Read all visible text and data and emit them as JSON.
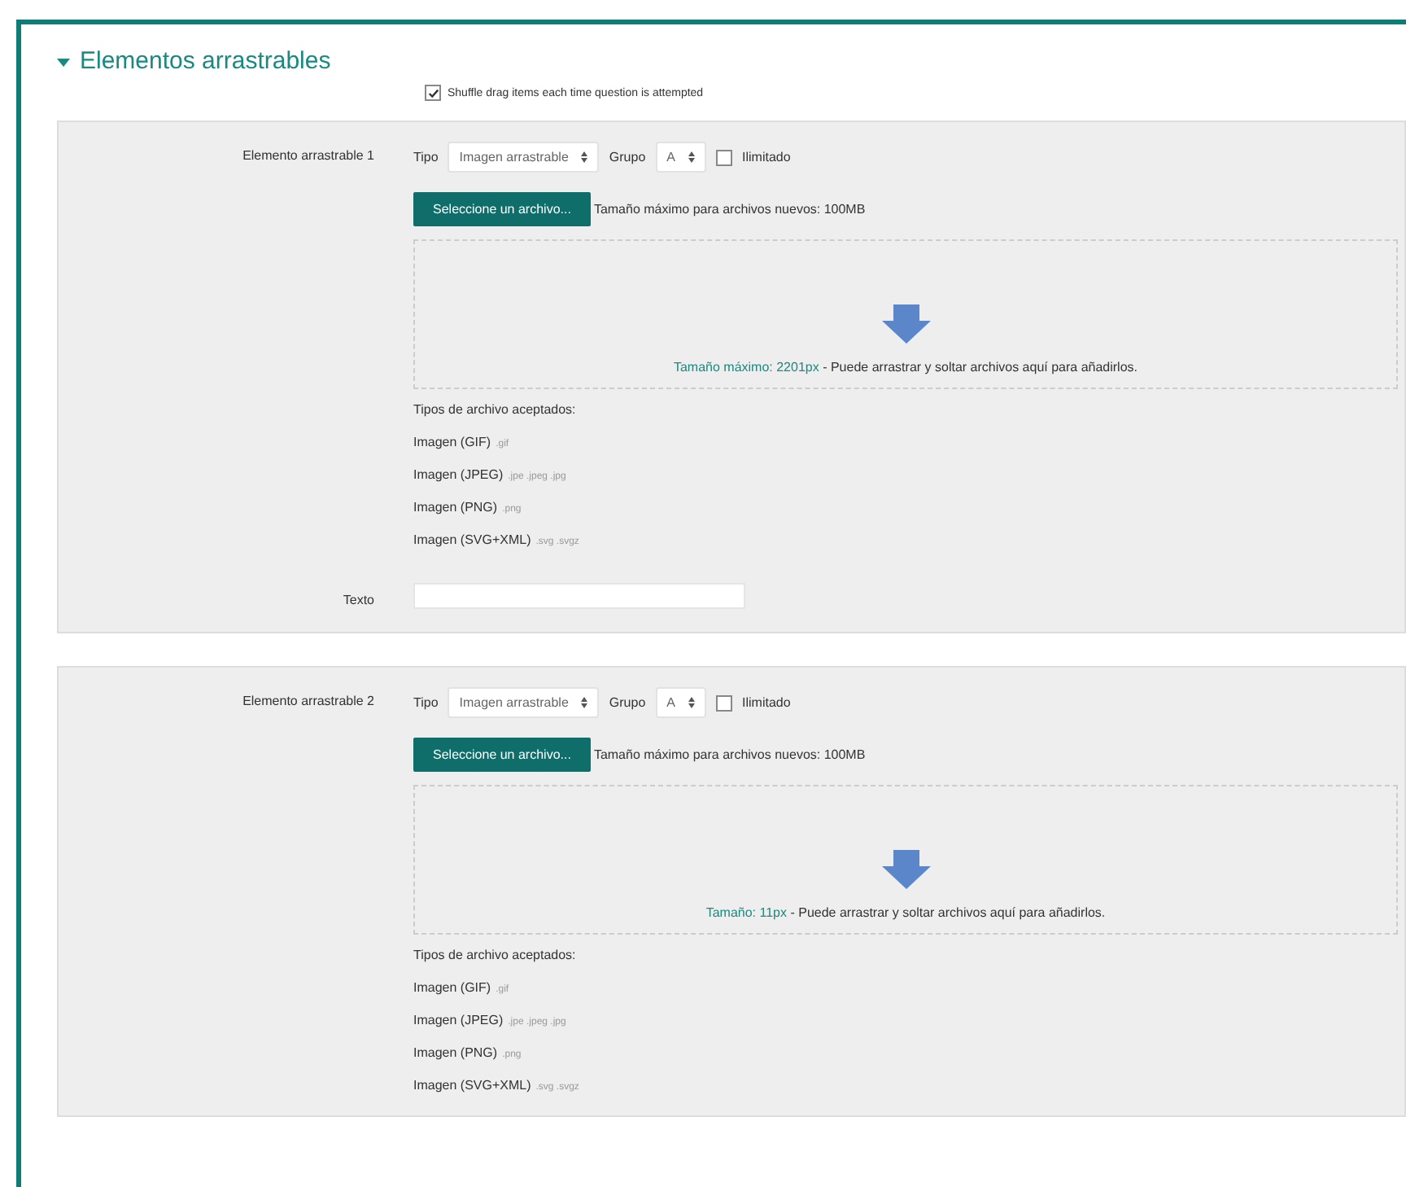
{
  "section": {
    "title": "Elementos arrastrables",
    "expanded": true
  },
  "shuffle": {
    "label": "Shuffle drag items each time question is attempted",
    "checked": true
  },
  "items": [
    {
      "label": "Elemento arrastrable 1",
      "type_label": "Tipo",
      "type_value": "Imagen arrastrable",
      "group_label": "Grupo",
      "group_value": "A",
      "unlimited": {
        "label": "Ilimitado",
        "checked": false
      },
      "file_button": "Seleccione un archivo...",
      "max_size": "Tamaño máximo para archivos nuevos: 100MB",
      "drop_link": "Tamaño máximo: 2201px",
      "drop_text": "- Puede arrastrar y soltar archivos aquí para añadirlos.",
      "accepted_title": "Tipos de archivo aceptados:",
      "accepted": [
        {
          "name": "Imagen (GIF)",
          "ext": ".gif"
        },
        {
          "name": "Imagen (JPEG)",
          "ext": ".jpe .jpeg .jpg"
        },
        {
          "name": "Imagen (PNG)",
          "ext": ".png"
        },
        {
          "name": "Imagen (SVG+XML)",
          "ext": ".svg .svgz"
        }
      ],
      "text_label": "Texto"
    },
    {
      "label": "Elemento arrastrable 2",
      "type_label": "Tipo",
      "type_value": "Imagen arrastrable",
      "group_label": "Grupo",
      "group_value": "A",
      "unlimited": {
        "label": "Ilimitado",
        "checked": false
      },
      "file_button": "Seleccione un archivo...",
      "max_size": "Tamaño máximo para archivos nuevos: 100MB",
      "drop_link": "Tamaño: 11px",
      "drop_text": "- Puede arrastrar y soltar archivos aquí para añadirlos.",
      "accepted_title": "Tipos de archivo aceptados:",
      "accepted": [
        {
          "name": "Imagen (GIF)",
          "ext": ".gif"
        },
        {
          "name": "Imagen (JPEG)",
          "ext": ".jpe .jpeg .jpg"
        },
        {
          "name": "Imagen (PNG)",
          "ext": ".png"
        },
        {
          "name": "Imagen (SVG+XML)",
          "ext": ".svg .svgz"
        }
      ]
    }
  ]
}
